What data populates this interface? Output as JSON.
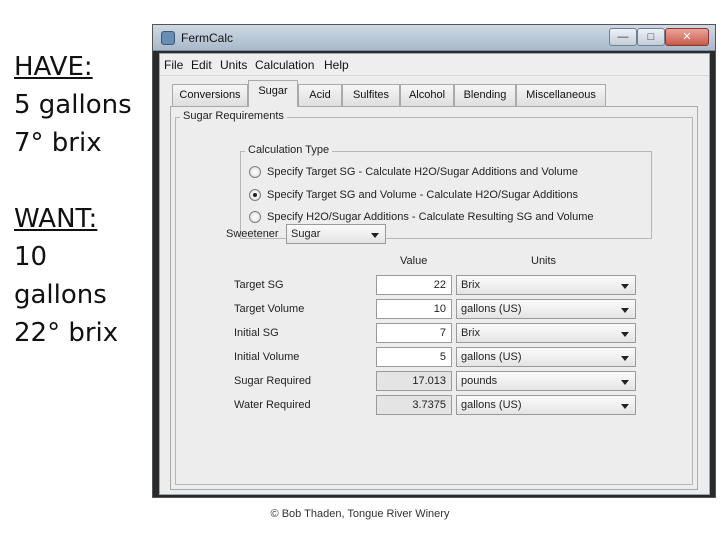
{
  "slide": {
    "have_heading": "HAVE:",
    "have_line1": "5 gallons",
    "have_line2": "7° brix",
    "want_heading": "WANT:",
    "want_line1": "10",
    "want_line2": "gallons",
    "want_line3": "22° brix",
    "copyright": "© Bob Thaden, Tongue River Winery"
  },
  "window": {
    "title": "FermCalc",
    "minimize_glyph": "—",
    "maximize_glyph": "□",
    "close_glyph": "✕"
  },
  "menu": [
    "File",
    "Edit",
    "Units",
    "Calculation",
    "Help"
  ],
  "tabs": [
    {
      "label": "Conversions",
      "active": false
    },
    {
      "label": "Sugar",
      "active": true
    },
    {
      "label": "Acid",
      "active": false
    },
    {
      "label": "Sulfites",
      "active": false
    },
    {
      "label": "Alcohol",
      "active": false
    },
    {
      "label": "Blending",
      "active": false
    },
    {
      "label": "Miscellaneous",
      "active": false
    }
  ],
  "panel": {
    "group_title": "Sugar Requirements",
    "calc_type_title": "Calculation Type",
    "calc_options": [
      {
        "label": "Specify Target SG - Calculate H2O/Sugar Additions and Volume",
        "selected": false
      },
      {
        "label": "Specify Target SG and Volume - Calculate H2O/Sugar Additions",
        "selected": true
      },
      {
        "label": "Specify H2O/Sugar Additions - Calculate Resulting SG and Volume",
        "selected": false
      }
    ],
    "sweetener_label": "Sweetener",
    "sweetener_value": "Sugar",
    "value_header": "Value",
    "units_header": "Units",
    "rows": [
      {
        "label": "Target SG",
        "value": "22",
        "unit": "Brix",
        "readonly": false
      },
      {
        "label": "Target Volume",
        "value": "10",
        "unit": "gallons (US)",
        "readonly": false
      },
      {
        "label": "Initial SG",
        "value": "7",
        "unit": "Brix",
        "readonly": false
      },
      {
        "label": "Initial Volume",
        "value": "5",
        "unit": "gallons (US)",
        "readonly": false
      },
      {
        "label": "Sugar Required",
        "value": "17.013",
        "unit": "pounds",
        "readonly": true
      },
      {
        "label": "Water Required",
        "value": "3.7375",
        "unit": "gallons (US)",
        "readonly": true
      }
    ]
  },
  "colors": {
    "titlebar": "#b9c7d6",
    "panel_bg": "#ededed",
    "close_button": "#c85b48"
  }
}
